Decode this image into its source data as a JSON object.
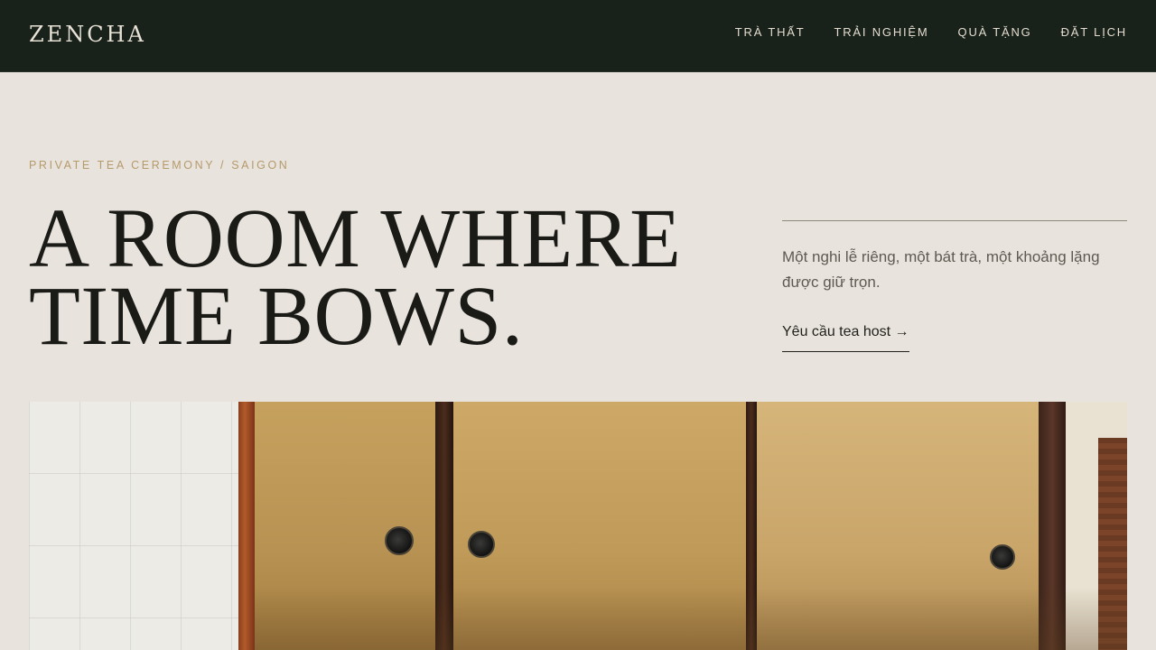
{
  "brand": {
    "logo": "ZENCHA"
  },
  "nav": {
    "items": [
      {
        "label": "TRÀ THẤT"
      },
      {
        "label": "TRẢI NGHIỆM"
      },
      {
        "label": "QUÀ TẶNG"
      },
      {
        "label": "ĐẶT LỊCH"
      }
    ]
  },
  "hero": {
    "eyebrow": "PRIVATE TEA CEREMONY / SAIGON",
    "headline_line1": "A ROOM WHERE",
    "headline_line2": "TIME BOWS.",
    "description": "Một nghi lễ riêng, một bát trà, một khoảng lặng được giữ trọn.",
    "cta_label": "Yêu cầu tea host →",
    "image_alt": "Tea room with sliding fusuma doors"
  },
  "colors": {
    "header_bg": "#19221a",
    "page_bg": "#e8e3dc",
    "accent_gold": "#b59a6c",
    "headline": "#1a1a16"
  }
}
